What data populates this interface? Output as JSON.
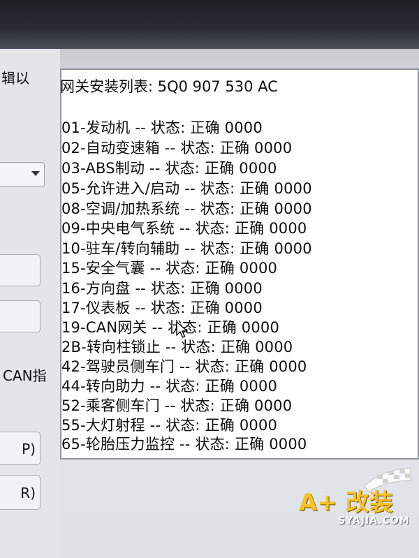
{
  "left_panel": {
    "caption_top": "辑以",
    "button_1_label": "",
    "button_2_label": "",
    "caption_can": "CAN指",
    "button_p_label": "P)",
    "button_r_label": "R)"
  },
  "gateway": {
    "title": "网关安装列表:  5Q0 907 530 AC",
    "modules": [
      "01-发动机 -- 状态: 正确 0000",
      "02-自动变速箱 -- 状态: 正确 0000",
      "03-ABS制动 -- 状态: 正确 0000",
      "05-允许进入/启动 -- 状态: 正确 0000",
      "08-空调/加热系统 -- 状态: 正确 0000",
      "09-中央电气系统 -- 状态: 正确 0000",
      "10-驻车/转向辅助 -- 状态: 正确 0000",
      "15-安全气囊 -- 状态: 正确 0000",
      "16-方向盘 -- 状态: 正确 0000",
      "17-仪表板 -- 状态: 正确 0000",
      "19-CAN网关 -- 状态: 正确 0000",
      "2B-转向柱锁止 -- 状态: 正确 0000",
      "42-驾驶员侧车门 -- 状态: 正确 0000",
      "44-转向助力 -- 状态: 正确 0000",
      "52-乘客侧车门 -- 状态: 正确 0000",
      "55-大灯射程 -- 状态: 正确 0000",
      "65-轮胎压力监控 -- 状态: 正确 0000"
    ]
  },
  "watermark": {
    "logo_text": "A+ 改装",
    "url": "SYAJIA.COM"
  },
  "colors": {
    "text": "#0d0d0d",
    "panel_background": "#ffffff",
    "watermark_gold": "#f6c22a"
  }
}
